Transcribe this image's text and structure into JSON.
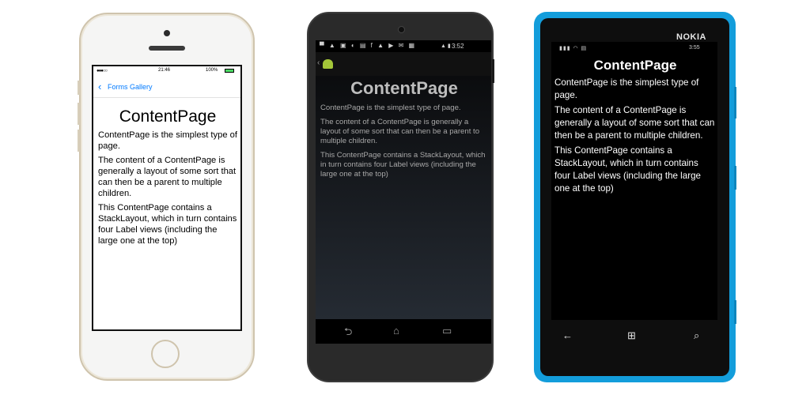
{
  "ios": {
    "status": {
      "signal": "●●●○○",
      "time": "21:46",
      "battery": "100%"
    },
    "nav": {
      "back_icon": "‹",
      "back_label": "Forms Gallery"
    },
    "title": "ContentPage",
    "paragraphs": [
      "ContentPage is the simplest type of page.",
      "The content of a ContentPage is generally a layout of some sort that can then be a parent to multiple children.",
      "This ContentPage contains a StackLayout, which in turn contains four Label views (including the large one at the top)"
    ]
  },
  "android": {
    "status": {
      "icons": "▀ ▲ ▣ ◐ ▤ f ▲ ▶ ✉ ▦",
      "time": "3:52",
      "signal": "▲ ▮"
    },
    "up_icon": "‹",
    "title": "ContentPage",
    "paragraphs": [
      "ContentPage is the simplest type of page.",
      "The content of a ContentPage is generally a layout of some sort that can then be a parent to multiple children.",
      "This ContentPage contains a StackLayout, which in turn contains four Label views (including the large one at the top)"
    ],
    "nav": {
      "back": "⮌",
      "home": "⌂",
      "recents": "▭"
    }
  },
  "wp": {
    "brand": "NOKIA",
    "status": {
      "icons": "▮▮▮ ◠ ▤",
      "time": "3:55"
    },
    "title": "ContentPage",
    "paragraphs": [
      "ContentPage is the simplest type of page.",
      "The content of a ContentPage is generally a layout of some sort that can then be a parent to multiple children.",
      "This ContentPage contains a StackLayout, which in turn contains four Label views (including the large one at the top)"
    ],
    "nav": {
      "back": "←",
      "start": "⊞",
      "search": "⌕"
    }
  }
}
